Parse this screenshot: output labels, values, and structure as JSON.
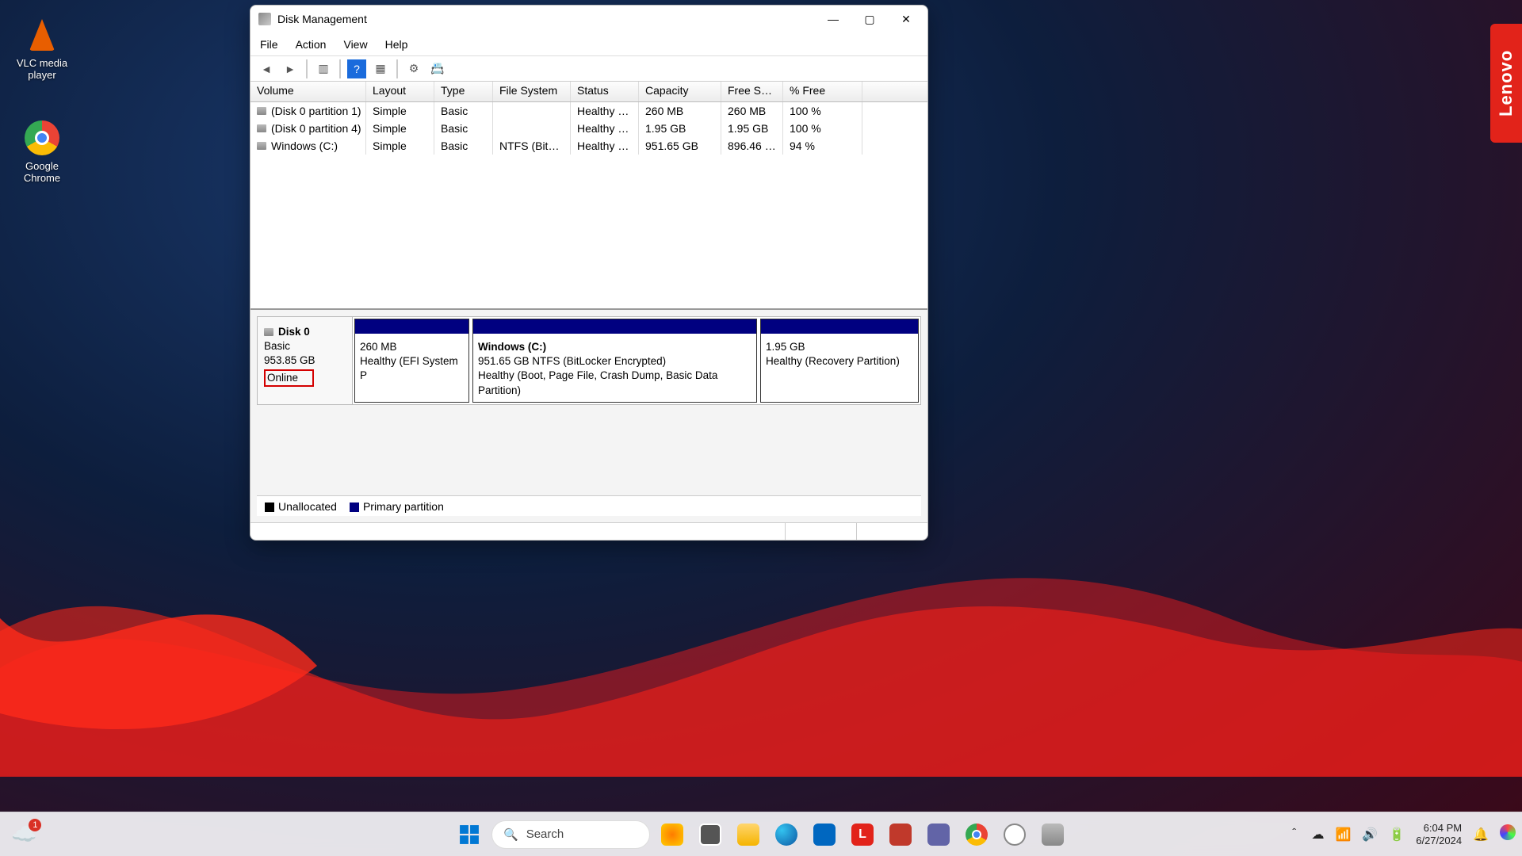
{
  "desktop_icons": {
    "vlc": "VLC media player",
    "chrome": "Google Chrome"
  },
  "brand_tag": "Lenovo",
  "window": {
    "title": "Disk Management",
    "menu": {
      "file": "File",
      "action": "Action",
      "view": "View",
      "help": "Help"
    },
    "columns": {
      "volume": "Volume",
      "layout": "Layout",
      "type": "Type",
      "filesystem": "File System",
      "status": "Status",
      "capacity": "Capacity",
      "freespace": "Free Sp...",
      "pctfree": "% Free"
    },
    "rows": [
      {
        "volume": "(Disk 0 partition 1)",
        "layout": "Simple",
        "type": "Basic",
        "fs": "",
        "status": "Healthy (E...",
        "capacity": "260 MB",
        "free": "260 MB",
        "pct": "100 %"
      },
      {
        "volume": "(Disk 0 partition 4)",
        "layout": "Simple",
        "type": "Basic",
        "fs": "",
        "status": "Healthy (R...",
        "capacity": "1.95 GB",
        "free": "1.95 GB",
        "pct": "100 %"
      },
      {
        "volume": "Windows (C:)",
        "layout": "Simple",
        "type": "Basic",
        "fs": "NTFS (BitLo...",
        "status": "Healthy (B...",
        "capacity": "951.65 GB",
        "free": "896.46 GB",
        "pct": "94 %"
      }
    ],
    "diskpane": {
      "name": "Disk 0",
      "kind": "Basic",
      "size": "953.85 GB",
      "state": "Online",
      "parts": [
        {
          "title": "",
          "line1": "260 MB",
          "line2": "Healthy (EFI System P"
        },
        {
          "title": "Windows  (C:)",
          "line1": "951.65 GB NTFS (BitLocker Encrypted)",
          "line2": "Healthy (Boot, Page File, Crash Dump, Basic Data Partition)"
        },
        {
          "title": "",
          "line1": "1.95 GB",
          "line2": "Healthy (Recovery Partition)"
        }
      ]
    },
    "legend": {
      "unallocated": "Unallocated",
      "primary": "Primary partition"
    }
  },
  "taskbar": {
    "search_placeholder": "Search",
    "weather_badge": "1",
    "time": "6:04 PM",
    "date": "6/27/2024"
  }
}
